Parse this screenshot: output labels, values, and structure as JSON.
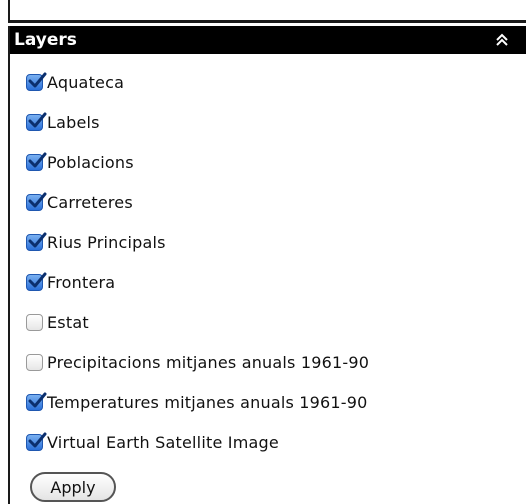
{
  "panel": {
    "title": "Layers",
    "collapse_icon": "double-chevron-up-icon"
  },
  "layers": [
    {
      "label": "Aquateca",
      "checked": true
    },
    {
      "label": "Labels",
      "checked": true
    },
    {
      "label": "Poblacions",
      "checked": true
    },
    {
      "label": "Carreteres",
      "checked": true
    },
    {
      "label": "Rius Principals",
      "checked": true
    },
    {
      "label": "Frontera",
      "checked": true
    },
    {
      "label": "Estat",
      "checked": false
    },
    {
      "label": "Precipitacions mitjanes anuals 1961-90",
      "checked": false
    },
    {
      "label": "Temperatures mitjanes anuals 1961-90",
      "checked": true
    },
    {
      "label": "Virtual Earth Satellite Image",
      "checked": true
    }
  ],
  "apply_label": "Apply",
  "colors": {
    "header_bg": "#000000",
    "header_text": "#ffffff",
    "checkbox_checked": "#2a6fd8"
  }
}
